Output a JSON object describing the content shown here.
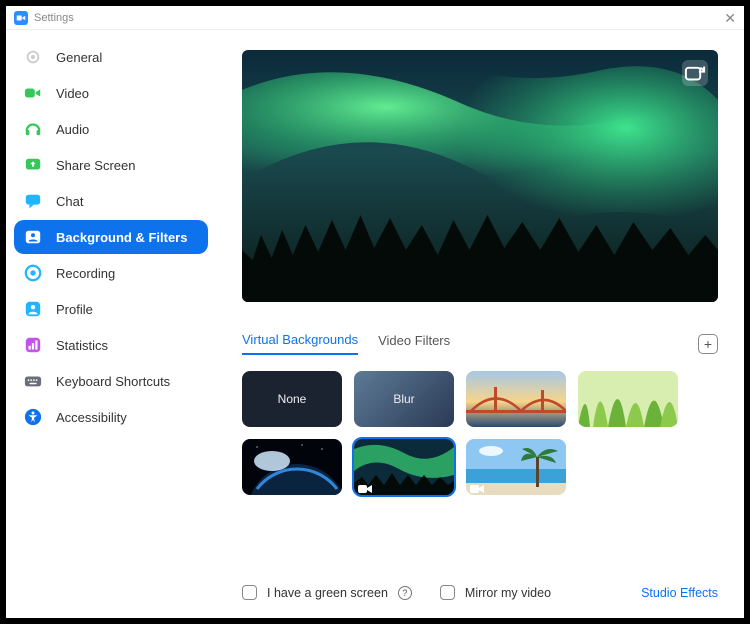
{
  "window": {
    "title": "Settings"
  },
  "sidebar": {
    "items": [
      {
        "label": "General"
      },
      {
        "label": "Video"
      },
      {
        "label": "Audio"
      },
      {
        "label": "Share Screen"
      },
      {
        "label": "Chat"
      },
      {
        "label": "Background & Filters"
      },
      {
        "label": "Recording"
      },
      {
        "label": "Profile"
      },
      {
        "label": "Statistics"
      },
      {
        "label": "Keyboard Shortcuts"
      },
      {
        "label": "Accessibility"
      }
    ]
  },
  "tabs": {
    "virtual_backgrounds": "Virtual Backgrounds",
    "video_filters": "Video Filters"
  },
  "backgrounds": {
    "none": "None",
    "blur": "Blur"
  },
  "footer": {
    "green_screen": "I have a green screen",
    "mirror": "Mirror my video",
    "studio_effects": "Studio Effects"
  }
}
